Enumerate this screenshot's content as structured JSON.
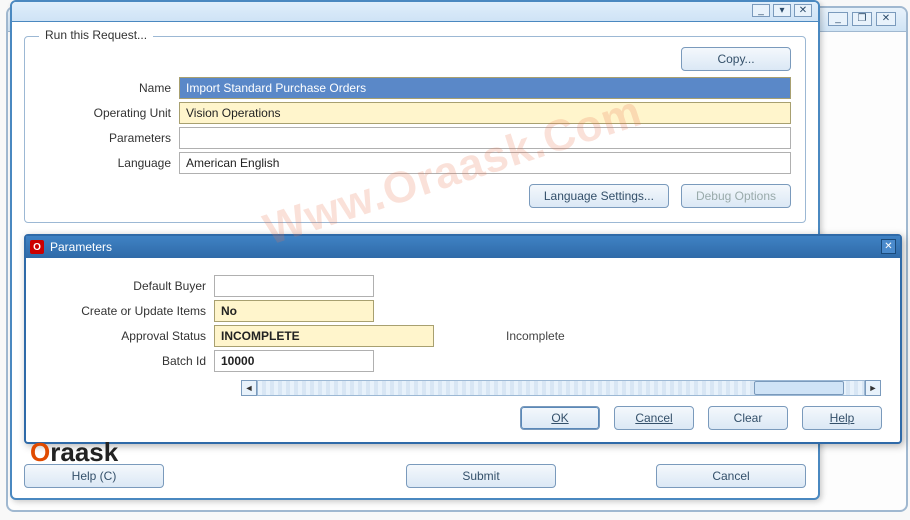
{
  "bg": {
    "minimize": "_",
    "restore": "❐",
    "close": "✕"
  },
  "request": {
    "group_title": "Run this Request...",
    "copy_label": "Copy...",
    "fields": {
      "name_label": "Name",
      "name_value": "Import Standard Purchase Orders",
      "ou_label": "Operating Unit",
      "ou_value": "Vision Operations",
      "params_label": "Parameters",
      "params_value": "",
      "lang_label": "Language",
      "lang_value": "American English"
    },
    "lang_settings_label": "Language Settings...",
    "debug_label": "Debug Options",
    "help_label": "Help (C)",
    "submit_label": "Submit",
    "cancel_label": "Cancel",
    "minimize": "_",
    "restore": "▾",
    "close": "✕"
  },
  "param": {
    "title": "Parameters",
    "close": "✕",
    "fields": {
      "buyer_label": "Default Buyer",
      "buyer_value": "",
      "create_label": "Create or Update Items",
      "create_value": "No",
      "approval_label": "Approval Status",
      "approval_value": "INCOMPLETE",
      "approval_status_text": "Incomplete",
      "batch_label": "Batch Id",
      "batch_value": "10000"
    },
    "scroll_left": "◄",
    "scroll_right": "►",
    "ok_label": "OK",
    "cancel_label": "Cancel",
    "clear_label": "Clear",
    "help_label": "Help"
  },
  "watermark": "Www.Oraask.Com",
  "brand_o": "O",
  "brand_text": "raask"
}
